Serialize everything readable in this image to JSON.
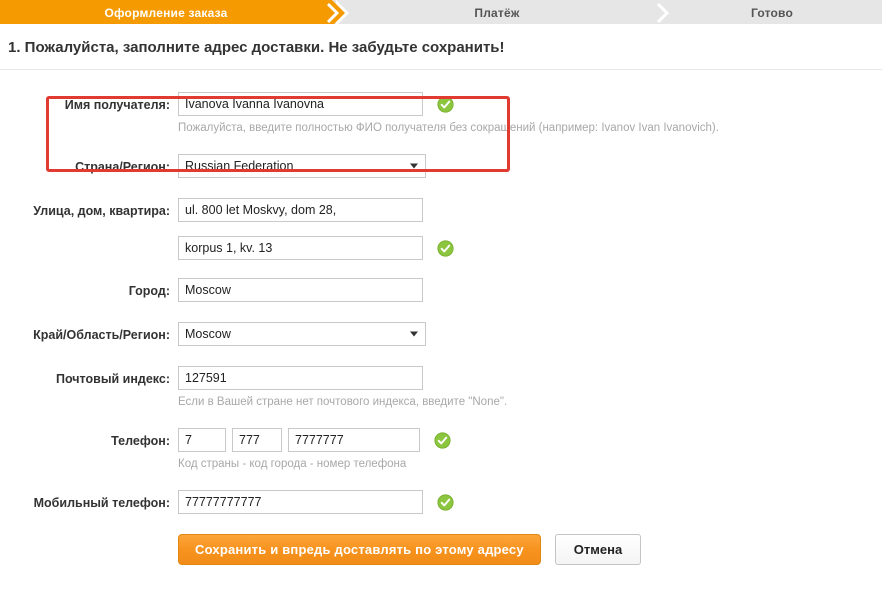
{
  "steps": {
    "items": [
      {
        "label": "Оформление заказа",
        "state": "active"
      },
      {
        "label": "Платёж",
        "state": "inactive"
      },
      {
        "label": "Готово",
        "state": "inactive"
      }
    ],
    "active_color": "#f59a00",
    "inactive_color": "#e6e6e6"
  },
  "heading": "1. Пожалуйста, заполните адрес доставки. Не забудьте сохранить!",
  "annotation": {
    "color": "#e03a31",
    "target": "recipient-name-field"
  },
  "form": {
    "recipient_name": {
      "label": "Имя получателя:",
      "value": "Ivanova Ivanna Ivanovna",
      "placeholder": "",
      "valid": true,
      "hint": "Пожалуйста, введите полностью ФИО получателя без сокращений (например: Ivanov Ivan Ivanovich)."
    },
    "country": {
      "label": "Страна/Регион:",
      "value": "Russian Federation",
      "options": [
        "Russian Federation"
      ]
    },
    "street": {
      "label": "Улица, дом, квартира:",
      "line1": "ul. 800 let Moskvy, dom 28,",
      "line2": "korpus 1, kv. 13",
      "placeholder": "",
      "valid": true
    },
    "city": {
      "label": "Город:",
      "value": "Moscow",
      "placeholder": ""
    },
    "region": {
      "label": "Край/Область/Регион:",
      "value": "Moscow",
      "options": [
        "Moscow"
      ]
    },
    "postal_code": {
      "label": "Почтовый индекс:",
      "value": "127591",
      "placeholder": "",
      "hint": "Если в Вашей стране нет почтового индекса, введите \"None\"."
    },
    "phone": {
      "label": "Телефон:",
      "country_code": "7",
      "city_code": "777",
      "number": "7777777",
      "valid": true,
      "hint": "Код страны - код города - номер телефона"
    },
    "mobile_phone": {
      "label": "Мобильный телефон:",
      "value": "77777777777",
      "placeholder": "",
      "valid": true
    }
  },
  "actions": {
    "save_label": "Сохранить и впредь доставлять по этому адресу",
    "cancel_label": "Отмена",
    "save_color": "#f7931e"
  },
  "icons": {
    "valid_check": "check-circle-icon",
    "dropdown": "chevron-down-icon"
  }
}
